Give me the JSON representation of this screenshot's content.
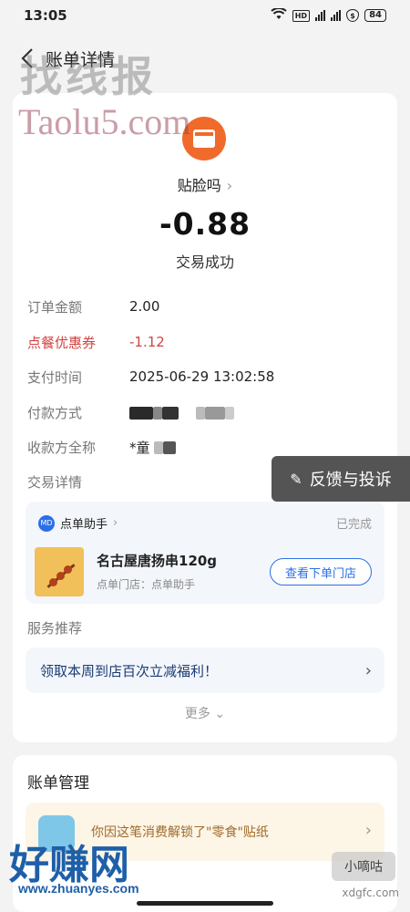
{
  "status_bar": {
    "time": "13:05",
    "battery": "84",
    "hd": "HD"
  },
  "nav": {
    "title": "账单详情"
  },
  "merchant": {
    "name": "贴脸吗",
    "amount": "-0.88",
    "status": "交易成功"
  },
  "rows": [
    {
      "label": "订单金额",
      "value": "2.00"
    },
    {
      "label": "点餐优惠券",
      "value": "-1.12"
    },
    {
      "label": "支付时间",
      "value": "2025-06-29 13:02:58"
    },
    {
      "label": "付款方式",
      "value": ""
    },
    {
      "label": "收款方全称",
      "value": "*童"
    }
  ],
  "details": {
    "section_label": "交易详情",
    "helper": "点单助手",
    "helper_badge": "MD",
    "status": "已完成",
    "product_name": "名古屋唐扬串120g",
    "store": "点单门店：点单助手",
    "store_button": "查看下单门店"
  },
  "service": {
    "section_label": "服务推荐",
    "promo": "领取本周到店百次立减福利！",
    "more": "更多"
  },
  "feedback": {
    "label": "反馈与投诉"
  },
  "management": {
    "title": "账单管理",
    "sticker_text": "你因这笔消费解锁了\"零食\"贴纸"
  },
  "watermarks": {
    "w1": "找线报",
    "w2": "Taolu5.com",
    "w3": "好赚网",
    "w4": "www.zhuanyes.com",
    "w5": "小嘀咕",
    "w6": "xdgfc.com"
  },
  "colors": {
    "accent_blue": "#2b6fe6",
    "discount_red": "#d24343",
    "merchant_orange": "#f06a2b"
  }
}
